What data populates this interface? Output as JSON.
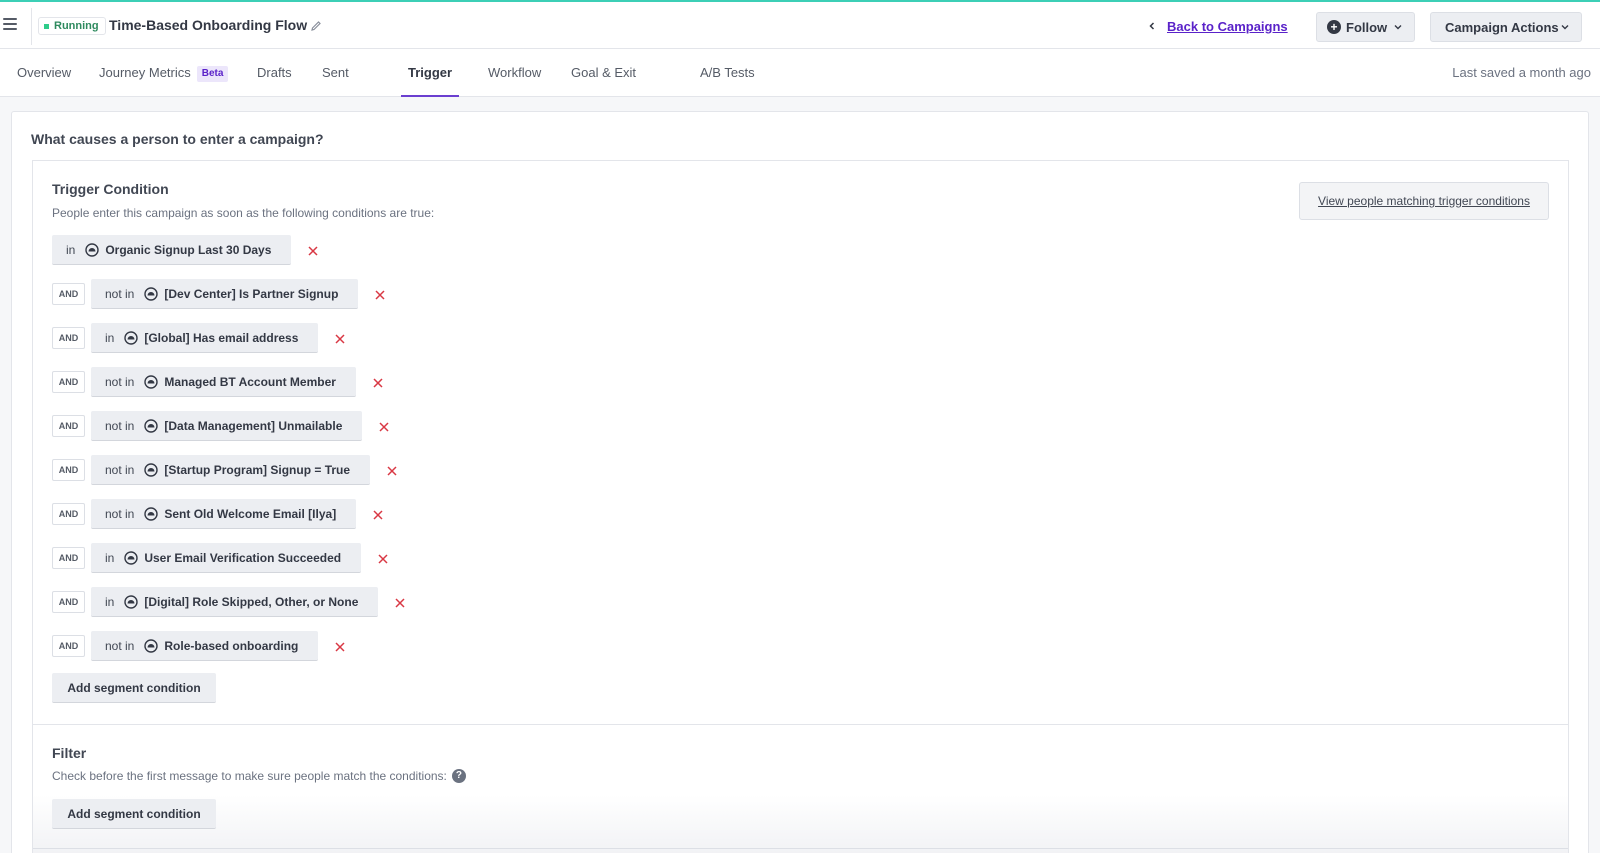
{
  "header": {
    "status": "Running",
    "title": "Time-Based Onboarding Flow",
    "back_link": "Back to Campaigns",
    "follow_label": "Follow",
    "actions_label": "Campaign Actions"
  },
  "tabs": [
    {
      "label": "Overview"
    },
    {
      "label": "Journey Metrics",
      "badge": "Beta"
    },
    {
      "label": "Drafts"
    },
    {
      "label": "Sent"
    },
    {
      "label": "Trigger",
      "active": true
    },
    {
      "label": "Workflow"
    },
    {
      "label": "Goal & Exit"
    },
    {
      "label": "A/B Tests"
    }
  ],
  "last_saved": "Last saved a month ago",
  "main": {
    "question": "What causes a person to enter a campaign?",
    "trigger": {
      "title": "Trigger Condition",
      "description": "People enter this campaign as soon as the following conditions are true:",
      "view_people": "View people matching trigger conditions",
      "and_label": "AND",
      "conditions": [
        {
          "op": "in",
          "segment": "Organic Signup Last 30 Days"
        },
        {
          "op": "not in",
          "segment": "[Dev Center] Is Partner Signup"
        },
        {
          "op": "in",
          "segment": "[Global] Has email address"
        },
        {
          "op": "not in",
          "segment": "Managed BT Account Member"
        },
        {
          "op": "not in",
          "segment": "[Data Management] Unmailable"
        },
        {
          "op": "not in",
          "segment": "[Startup Program] Signup = True"
        },
        {
          "op": "not in",
          "segment": "Sent Old Welcome Email [Ilya]"
        },
        {
          "op": "in",
          "segment": "User Email Verification Succeeded"
        },
        {
          "op": "in",
          "segment": "[Digital] Role Skipped, Other, or None"
        },
        {
          "op": "not in",
          "segment": "Role-based onboarding"
        }
      ],
      "add_label": "Add segment condition"
    },
    "filter": {
      "title": "Filter",
      "description": "Check before the first message to make sure people match the conditions:",
      "help_icon": "?",
      "add_label": "Add segment condition"
    }
  },
  "colors": {
    "accent": "#5a22c9",
    "running": "#2ecc8a",
    "remove": "#d93844"
  }
}
